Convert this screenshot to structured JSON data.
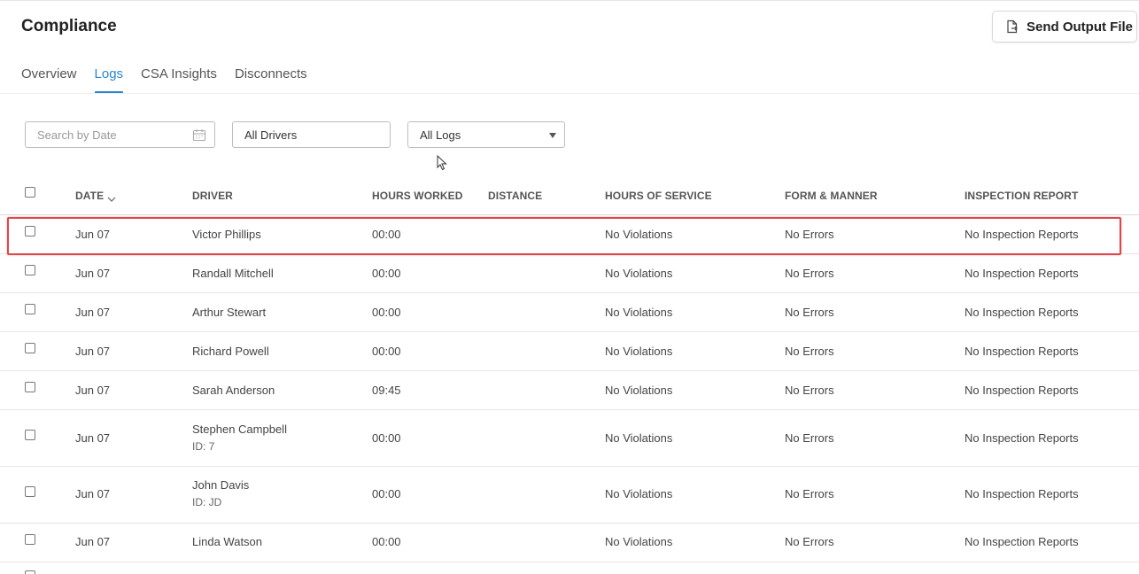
{
  "page": {
    "title": "Compliance"
  },
  "header": {
    "send_button_label": "Send Output File"
  },
  "tabs": [
    {
      "label": "Overview",
      "active": false
    },
    {
      "label": "Logs",
      "active": true
    },
    {
      "label": "CSA Insights",
      "active": false
    },
    {
      "label": "Disconnects",
      "active": false
    }
  ],
  "filters": {
    "date_placeholder": "Search by Date",
    "drivers_value": "All Drivers",
    "logs_value": "All Logs"
  },
  "table": {
    "columns": [
      "DATE",
      "DRIVER",
      "HOURS WORKED",
      "DISTANCE",
      "HOURS OF SERVICE",
      "FORM & MANNER",
      "INSPECTION REPORT"
    ],
    "rows": [
      {
        "date": "Jun 07",
        "driver": "Victor Phillips",
        "driver_id": "",
        "hours": "00:00",
        "distance": "",
        "hos": "No Violations",
        "form": "No Errors",
        "inspection": "No Inspection Reports",
        "highlighted": true
      },
      {
        "date": "Jun 07",
        "driver": "Randall Mitchell",
        "driver_id": "",
        "hours": "00:00",
        "distance": "",
        "hos": "No Violations",
        "form": "No Errors",
        "inspection": "No Inspection Reports",
        "highlighted": false
      },
      {
        "date": "Jun 07",
        "driver": "Arthur Stewart",
        "driver_id": "",
        "hours": "00:00",
        "distance": "",
        "hos": "No Violations",
        "form": "No Errors",
        "inspection": "No Inspection Reports",
        "highlighted": false
      },
      {
        "date": "Jun 07",
        "driver": "Richard Powell",
        "driver_id": "",
        "hours": "00:00",
        "distance": "",
        "hos": "No Violations",
        "form": "No Errors",
        "inspection": "No Inspection Reports",
        "highlighted": false
      },
      {
        "date": "Jun 07",
        "driver": "Sarah Anderson",
        "driver_id": "",
        "hours": "09:45",
        "distance": "",
        "hos": "No Violations",
        "form": "No Errors",
        "inspection": "No Inspection Reports",
        "highlighted": false
      },
      {
        "date": "Jun 07",
        "driver": "Stephen Campbell",
        "driver_id": "ID: 7",
        "hours": "00:00",
        "distance": "",
        "hos": "No Violations",
        "form": "No Errors",
        "inspection": "No Inspection Reports",
        "highlighted": false
      },
      {
        "date": "Jun 07",
        "driver": "John Davis",
        "driver_id": "ID: JD",
        "hours": "00:00",
        "distance": "",
        "hos": "No Violations",
        "form": "No Errors",
        "inspection": "No Inspection Reports",
        "highlighted": false
      },
      {
        "date": "Jun 07",
        "driver": "Linda Watson",
        "driver_id": "",
        "hours": "00:00",
        "distance": "",
        "hos": "No Violations",
        "form": "No Errors",
        "inspection": "No Inspection Reports",
        "highlighted": false
      }
    ]
  },
  "colors": {
    "accent": "#2a85d0",
    "highlight": "#e0454a"
  },
  "icons": {
    "send": "file-export-icon",
    "date": "calendar-icon",
    "sort": "chevron-down-icon",
    "dropdown": "caret-down-icon",
    "cursor": "mouse-pointer-icon"
  }
}
